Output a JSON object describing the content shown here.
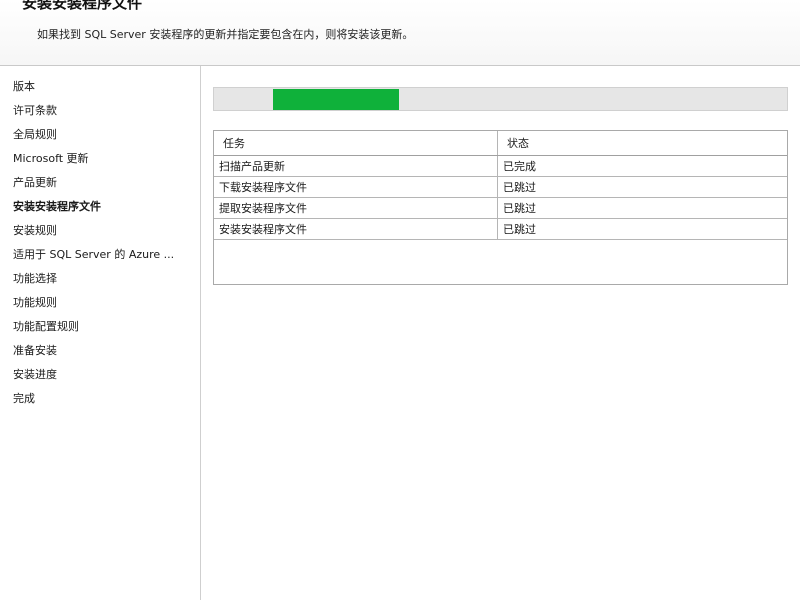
{
  "header": {
    "title": "安装安装程序文件",
    "subtitle": "如果找到 SQL Server 安装程序的更新并指定要包含在内，则将安装该更新。"
  },
  "sidebar": {
    "items": [
      {
        "label": "版本",
        "active": false
      },
      {
        "label": "许可条款",
        "active": false
      },
      {
        "label": "全局规则",
        "active": false
      },
      {
        "label": "Microsoft 更新",
        "active": false
      },
      {
        "label": "产品更新",
        "active": false
      },
      {
        "label": "安装安装程序文件",
        "active": true
      },
      {
        "label": "安装规则",
        "active": false
      },
      {
        "label": "适用于 SQL Server 的 Azure ...",
        "active": false
      },
      {
        "label": "功能选择",
        "active": false
      },
      {
        "label": "功能规则",
        "active": false
      },
      {
        "label": "功能配置规则",
        "active": false
      },
      {
        "label": "准备安装",
        "active": false
      },
      {
        "label": "安装进度",
        "active": false
      },
      {
        "label": "完成",
        "active": false
      }
    ]
  },
  "progress": {
    "start_fraction": 0.103,
    "value_fraction": 0.22,
    "color": "#0fb13a"
  },
  "task_table": {
    "columns": [
      "任务",
      "状态"
    ],
    "rows": [
      {
        "task": "扫描产品更新",
        "status": "已完成"
      },
      {
        "task": "下载安装程序文件",
        "status": "已跳过"
      },
      {
        "task": "提取安装程序文件",
        "status": "已跳过"
      },
      {
        "task": "安装安装程序文件",
        "status": "已跳过"
      }
    ]
  }
}
